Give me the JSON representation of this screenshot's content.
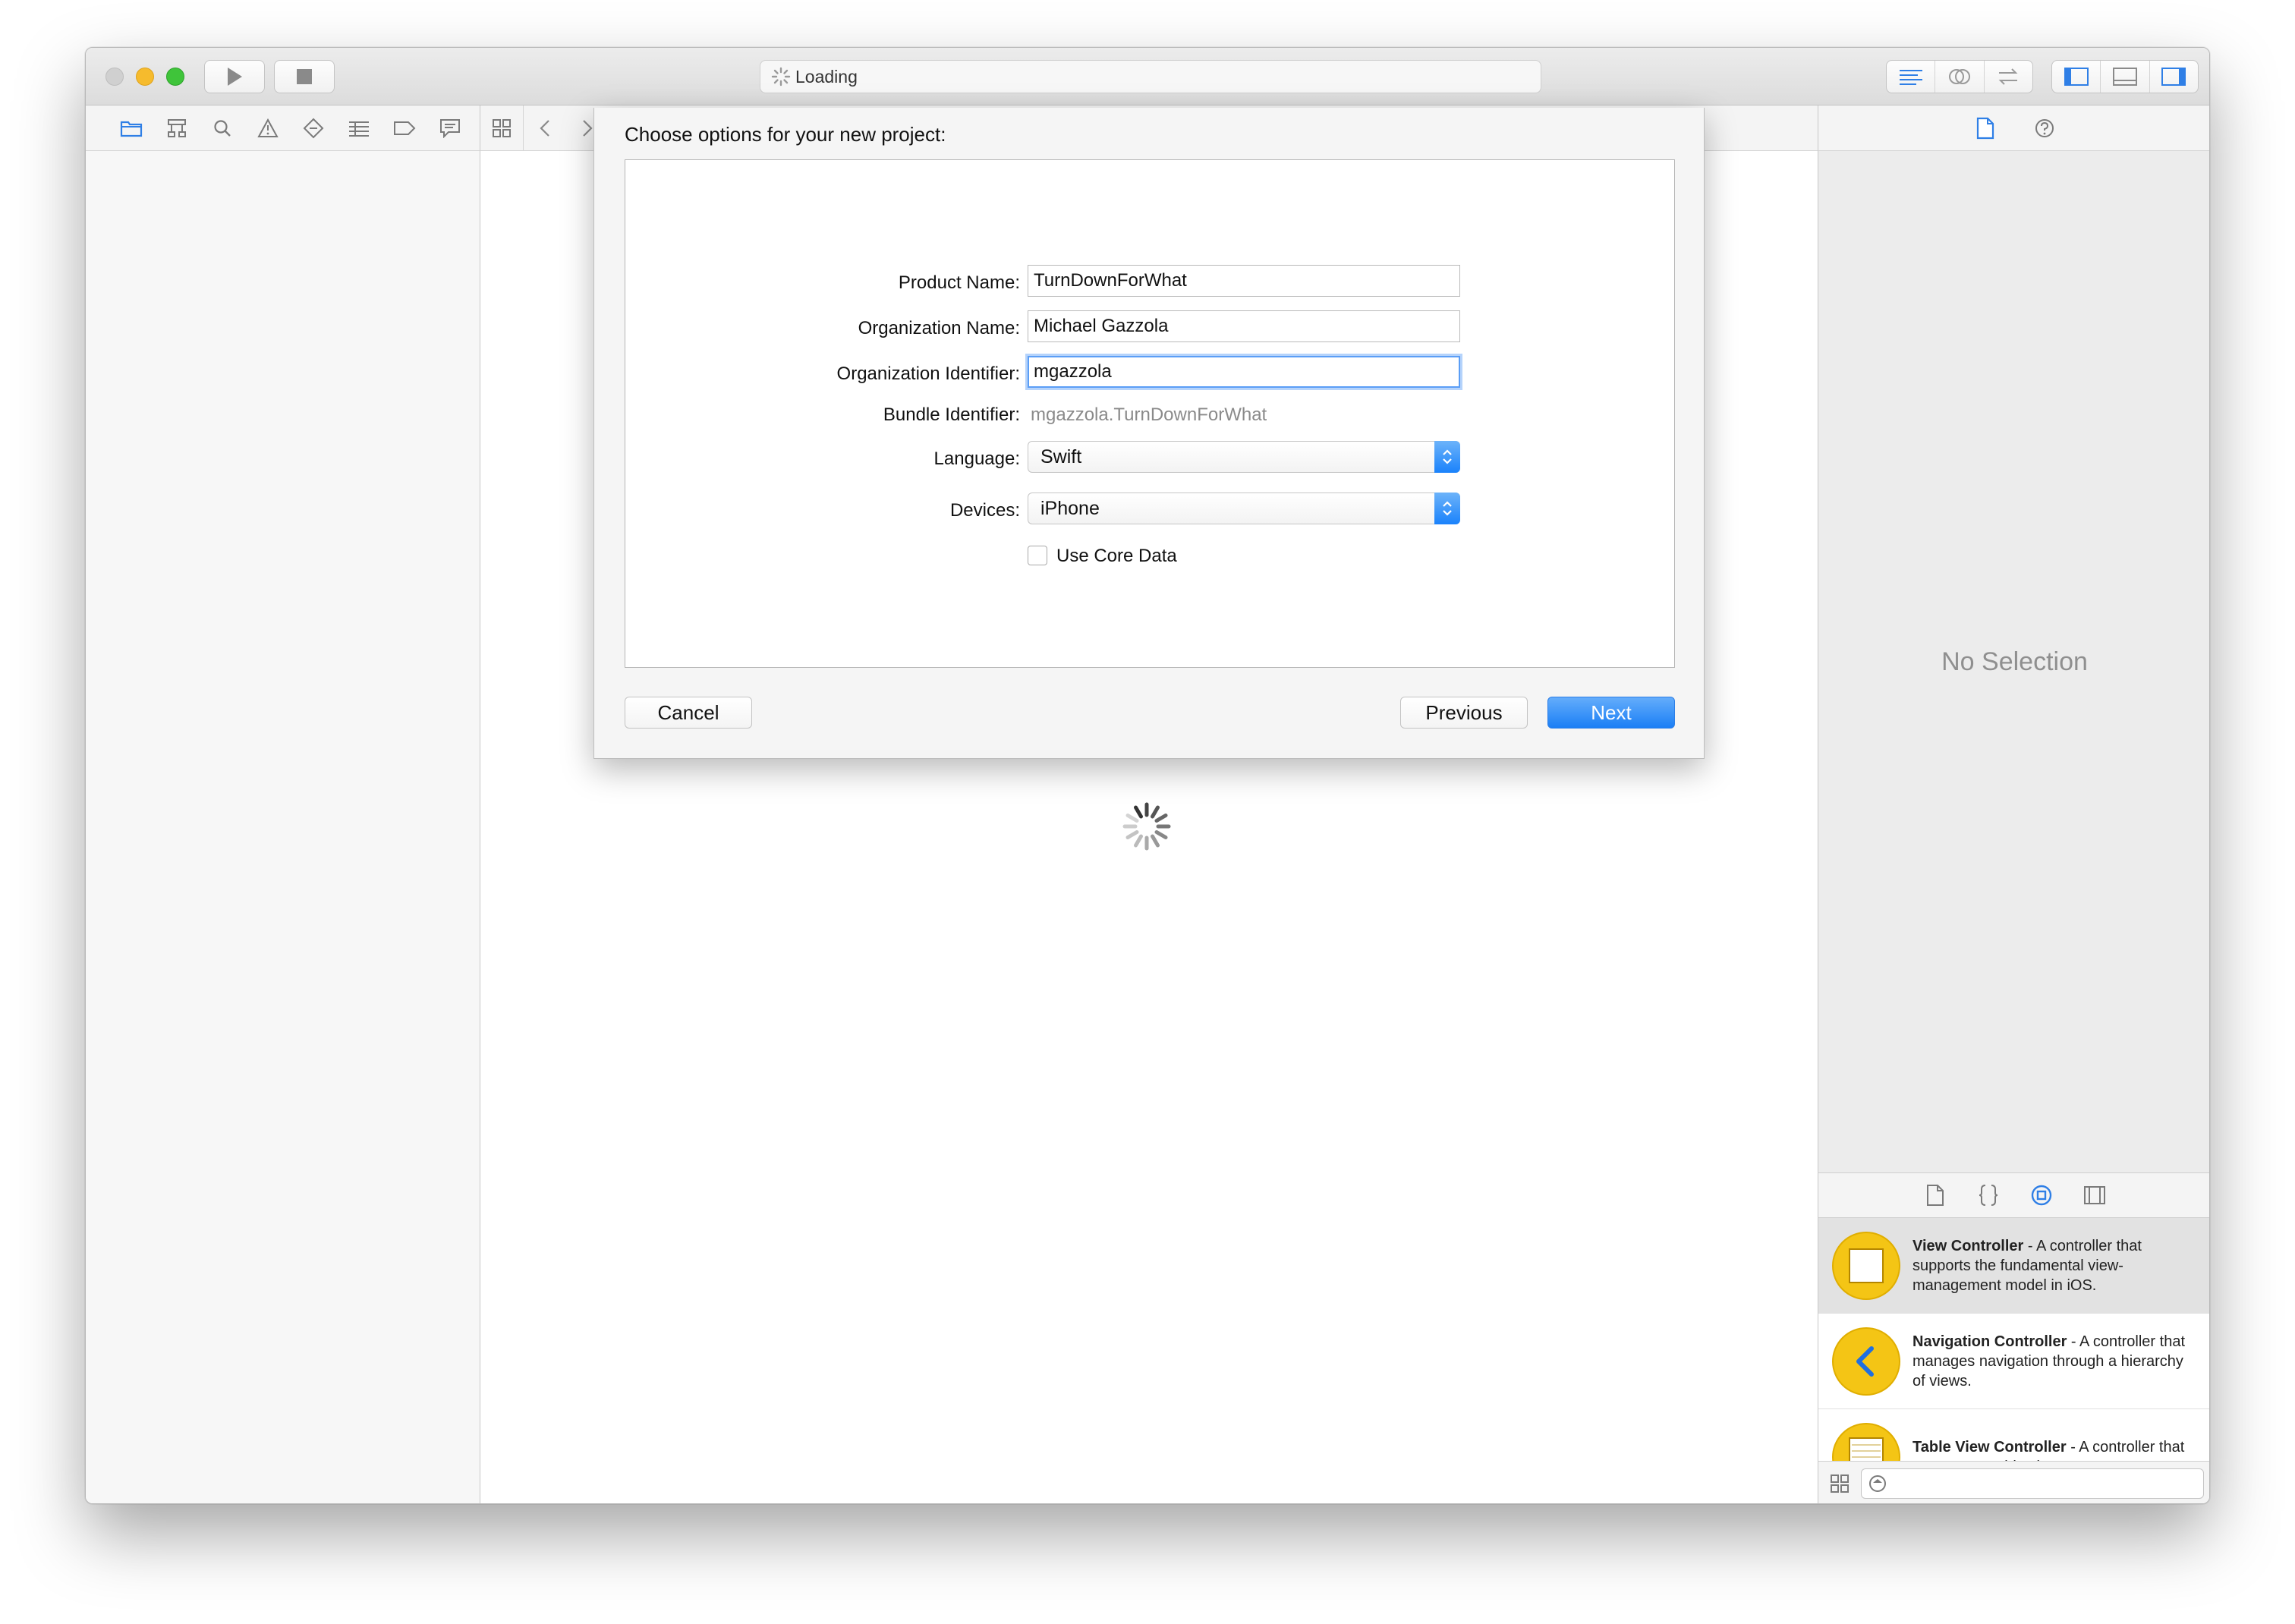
{
  "titlebar": {
    "activity_text": "Loading"
  },
  "dialog": {
    "title": "Choose options for your new project:",
    "fields": {
      "product_name": {
        "label": "Product Name:",
        "value": "TurnDownForWhat"
      },
      "organization_name": {
        "label": "Organization Name:",
        "value": "Michael Gazzola"
      },
      "organization_identifier": {
        "label": "Organization Identifier:",
        "value": "mgazzola"
      },
      "bundle_identifier": {
        "label": "Bundle Identifier:",
        "value": "mgazzola.TurnDownForWhat"
      },
      "language": {
        "label": "Language:",
        "value": "Swift"
      },
      "devices": {
        "label": "Devices:",
        "value": "iPhone"
      },
      "use_core_data": {
        "label": "Use Core Data",
        "checked": false
      }
    },
    "buttons": {
      "cancel": "Cancel",
      "previous": "Previous",
      "next": "Next"
    }
  },
  "inspector": {
    "no_selection": "No Selection"
  },
  "library": {
    "items": [
      {
        "title": "View Controller",
        "description": " - A controller that supports the fundamental view-management model in iOS.",
        "icon": "view-controller-icon"
      },
      {
        "title": "Navigation Controller",
        "description": " - A controller that manages navigation through a hierarchy of views.",
        "icon": "navigation-controller-icon"
      },
      {
        "title": "Table View Controller",
        "description": " - A controller that manages a table view.",
        "icon": "table-view-controller-icon"
      }
    ]
  },
  "colors": {
    "accent": "#1b7ff5",
    "library_icon": "#f4c515",
    "close": "#cfcfcf",
    "minimize": "#f5b92b",
    "zoom": "#3fc43a"
  }
}
